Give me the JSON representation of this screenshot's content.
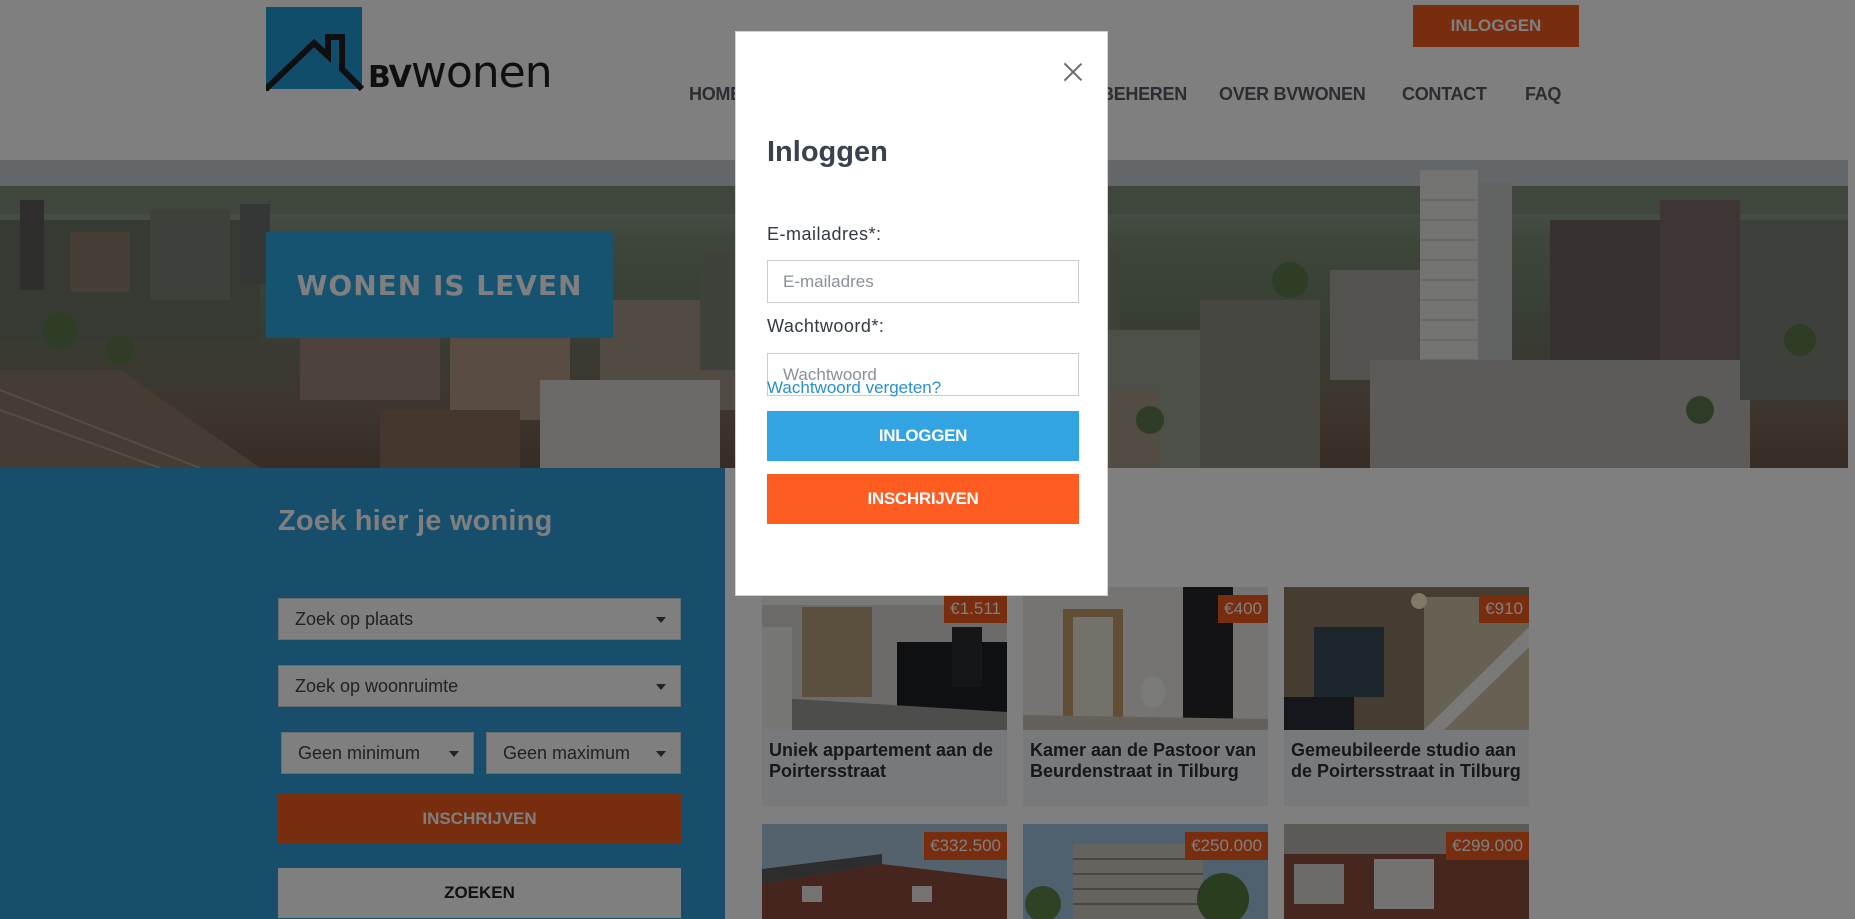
{
  "header": {
    "logo_bv": "BV",
    "logo_wonen": "wonen",
    "login_button": "INLOGGEN",
    "nav": [
      {
        "label": "HOME"
      },
      {
        "label": "BEHEREN"
      },
      {
        "label": "OVER BVWONEN"
      },
      {
        "label": "CONTACT"
      },
      {
        "label": "FAQ"
      }
    ]
  },
  "hero": {
    "banner": "WONEN IS LEVEN"
  },
  "search": {
    "title": "Zoek hier je woning",
    "place_select": "Zoek op plaats",
    "room_select": "Zoek op woonruimte",
    "min_select": "Geen minimum",
    "max_select": "Geen maximum",
    "register_button": "INSCHRIJVEN",
    "search_button": "ZOEKEN"
  },
  "listings": [
    {
      "price": "€1.511",
      "title": "Uniek appartement aan de Poirtersstraat"
    },
    {
      "price": "€400",
      "title": "Kamer aan de Pastoor van Beurdenstraat in Tilburg"
    },
    {
      "price": "€910",
      "title": "Gemeubileerde studio aan de Poirtersstraat in Tilburg"
    },
    {
      "price": "€332.500",
      "title": ""
    },
    {
      "price": "€250.000",
      "title": ""
    },
    {
      "price": "€299.000",
      "title": ""
    }
  ],
  "modal": {
    "title": "Inloggen",
    "email_label": "E-mailadres*:",
    "email_placeholder": "E-mailadres",
    "password_label": "Wachtwoord*:",
    "password_placeholder": "Wachtwoord",
    "forgot_link": "Wachtwoord vergeten?",
    "login_button": "INLOGGEN",
    "register_button": "INSCHRIJVEN"
  },
  "colors": {
    "brand_blue": "#2aa6e2",
    "brand_orange": "#f05a1e",
    "overlay": "rgba(0,0,0,0.5)"
  },
  "icons": {
    "close": "close-icon",
    "caret": "caret-down-icon",
    "logo": "house-roof-logo"
  }
}
